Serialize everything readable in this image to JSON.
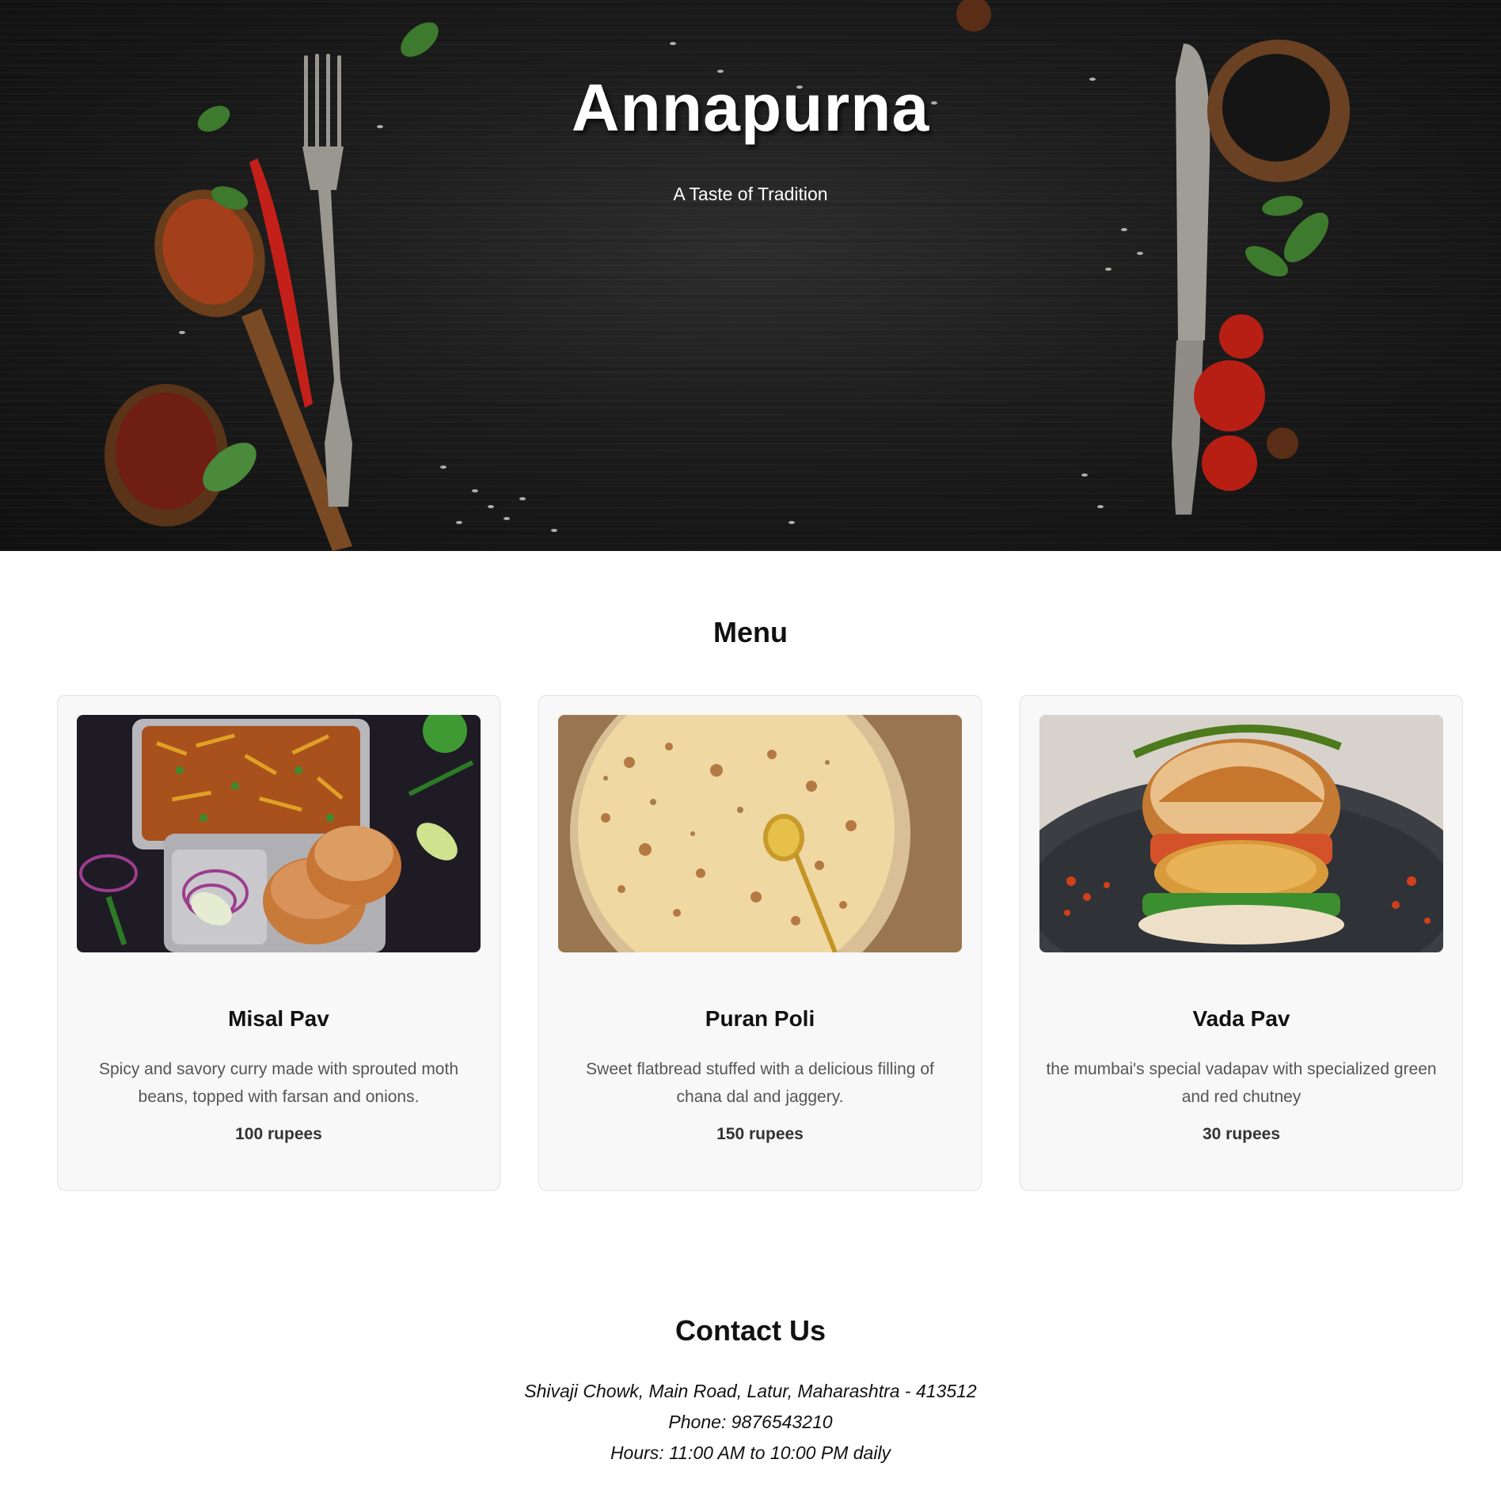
{
  "hero": {
    "title": "Annapurna",
    "subtitle": "A Taste of Tradition"
  },
  "menu": {
    "heading": "Menu",
    "items": [
      {
        "name": "Misal Pav",
        "description": "Spicy and savory curry made with sprouted moth beans, topped with farsan and onions.",
        "price": "100 rupees"
      },
      {
        "name": "Puran Poli",
        "description": "Sweet flatbread stuffed with a delicious filling of chana dal and jaggery.",
        "price": "150 rupees"
      },
      {
        "name": "Vada Pav",
        "description": "the mumbai's special vadapav with specialized green and red chutney",
        "price": "30 rupees"
      }
    ]
  },
  "contact": {
    "heading": "Contact Us",
    "address": "Shivaji Chowk, Main Road, Latur, Maharashtra - 413512",
    "phone": "Phone: 9876543210",
    "hours": "Hours: 11:00 AM to 10:00 PM daily"
  },
  "colors": {
    "hero_background": "#1a1a1a",
    "card_background": "#f8f8f8",
    "description_text": "#555555"
  }
}
